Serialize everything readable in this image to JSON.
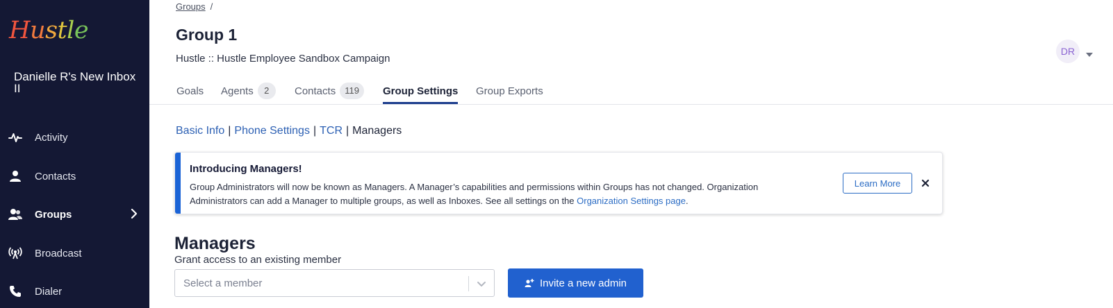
{
  "app": {
    "logo_text": "Hustle",
    "logo_letters": [
      "H",
      "u",
      "s",
      "t",
      "l",
      "e"
    ],
    "logo_colors": [
      "#f0553e",
      "#f07a3e",
      "#f0a93e",
      "#e0c63e",
      "#a9cf4e",
      "#78c25a"
    ]
  },
  "sidebar": {
    "org_name": "Danielle R's New Inbox II",
    "items": [
      {
        "label": "Activity",
        "icon": "activity-icon"
      },
      {
        "label": "Contacts",
        "icon": "person-icon"
      },
      {
        "label": "Groups",
        "icon": "groups-icon",
        "active": true
      },
      {
        "label": "Broadcast",
        "icon": "broadcast-icon"
      },
      {
        "label": "Dialer",
        "icon": "phone-icon"
      }
    ]
  },
  "header": {
    "breadcrumb_link": "Groups",
    "breadcrumb_sep": "/",
    "title": "Group 1",
    "subtitle": "Hustle :: Hustle Employee Sandbox Campaign",
    "avatar_initials": "DR"
  },
  "tabs": [
    {
      "label": "Goals"
    },
    {
      "label": "Agents",
      "badge": "2"
    },
    {
      "label": "Contacts",
      "badge": "119"
    },
    {
      "label": "Group Settings",
      "active": true
    },
    {
      "label": "Group Exports"
    }
  ],
  "subnav": {
    "items": [
      "Basic Info",
      "Phone Settings",
      "TCR"
    ],
    "current": "Managers",
    "separator": "|"
  },
  "alert": {
    "title": "Introducing Managers!",
    "body_before_link": "Group Administrators will now be known as Managers. A Manager’s capabilities and permissions within Groups has not changed. Organization Administrators can add a Manager to multiple groups, as well as Inboxes. See all settings on the ",
    "link_text": "Organization Settings page",
    "body_after_link": ".",
    "learn_more": "Learn More"
  },
  "managers": {
    "title": "Managers",
    "subtitle": "Grant access to an existing member",
    "select_placeholder": "Select a member",
    "invite_button": "Invite a new admin"
  }
}
